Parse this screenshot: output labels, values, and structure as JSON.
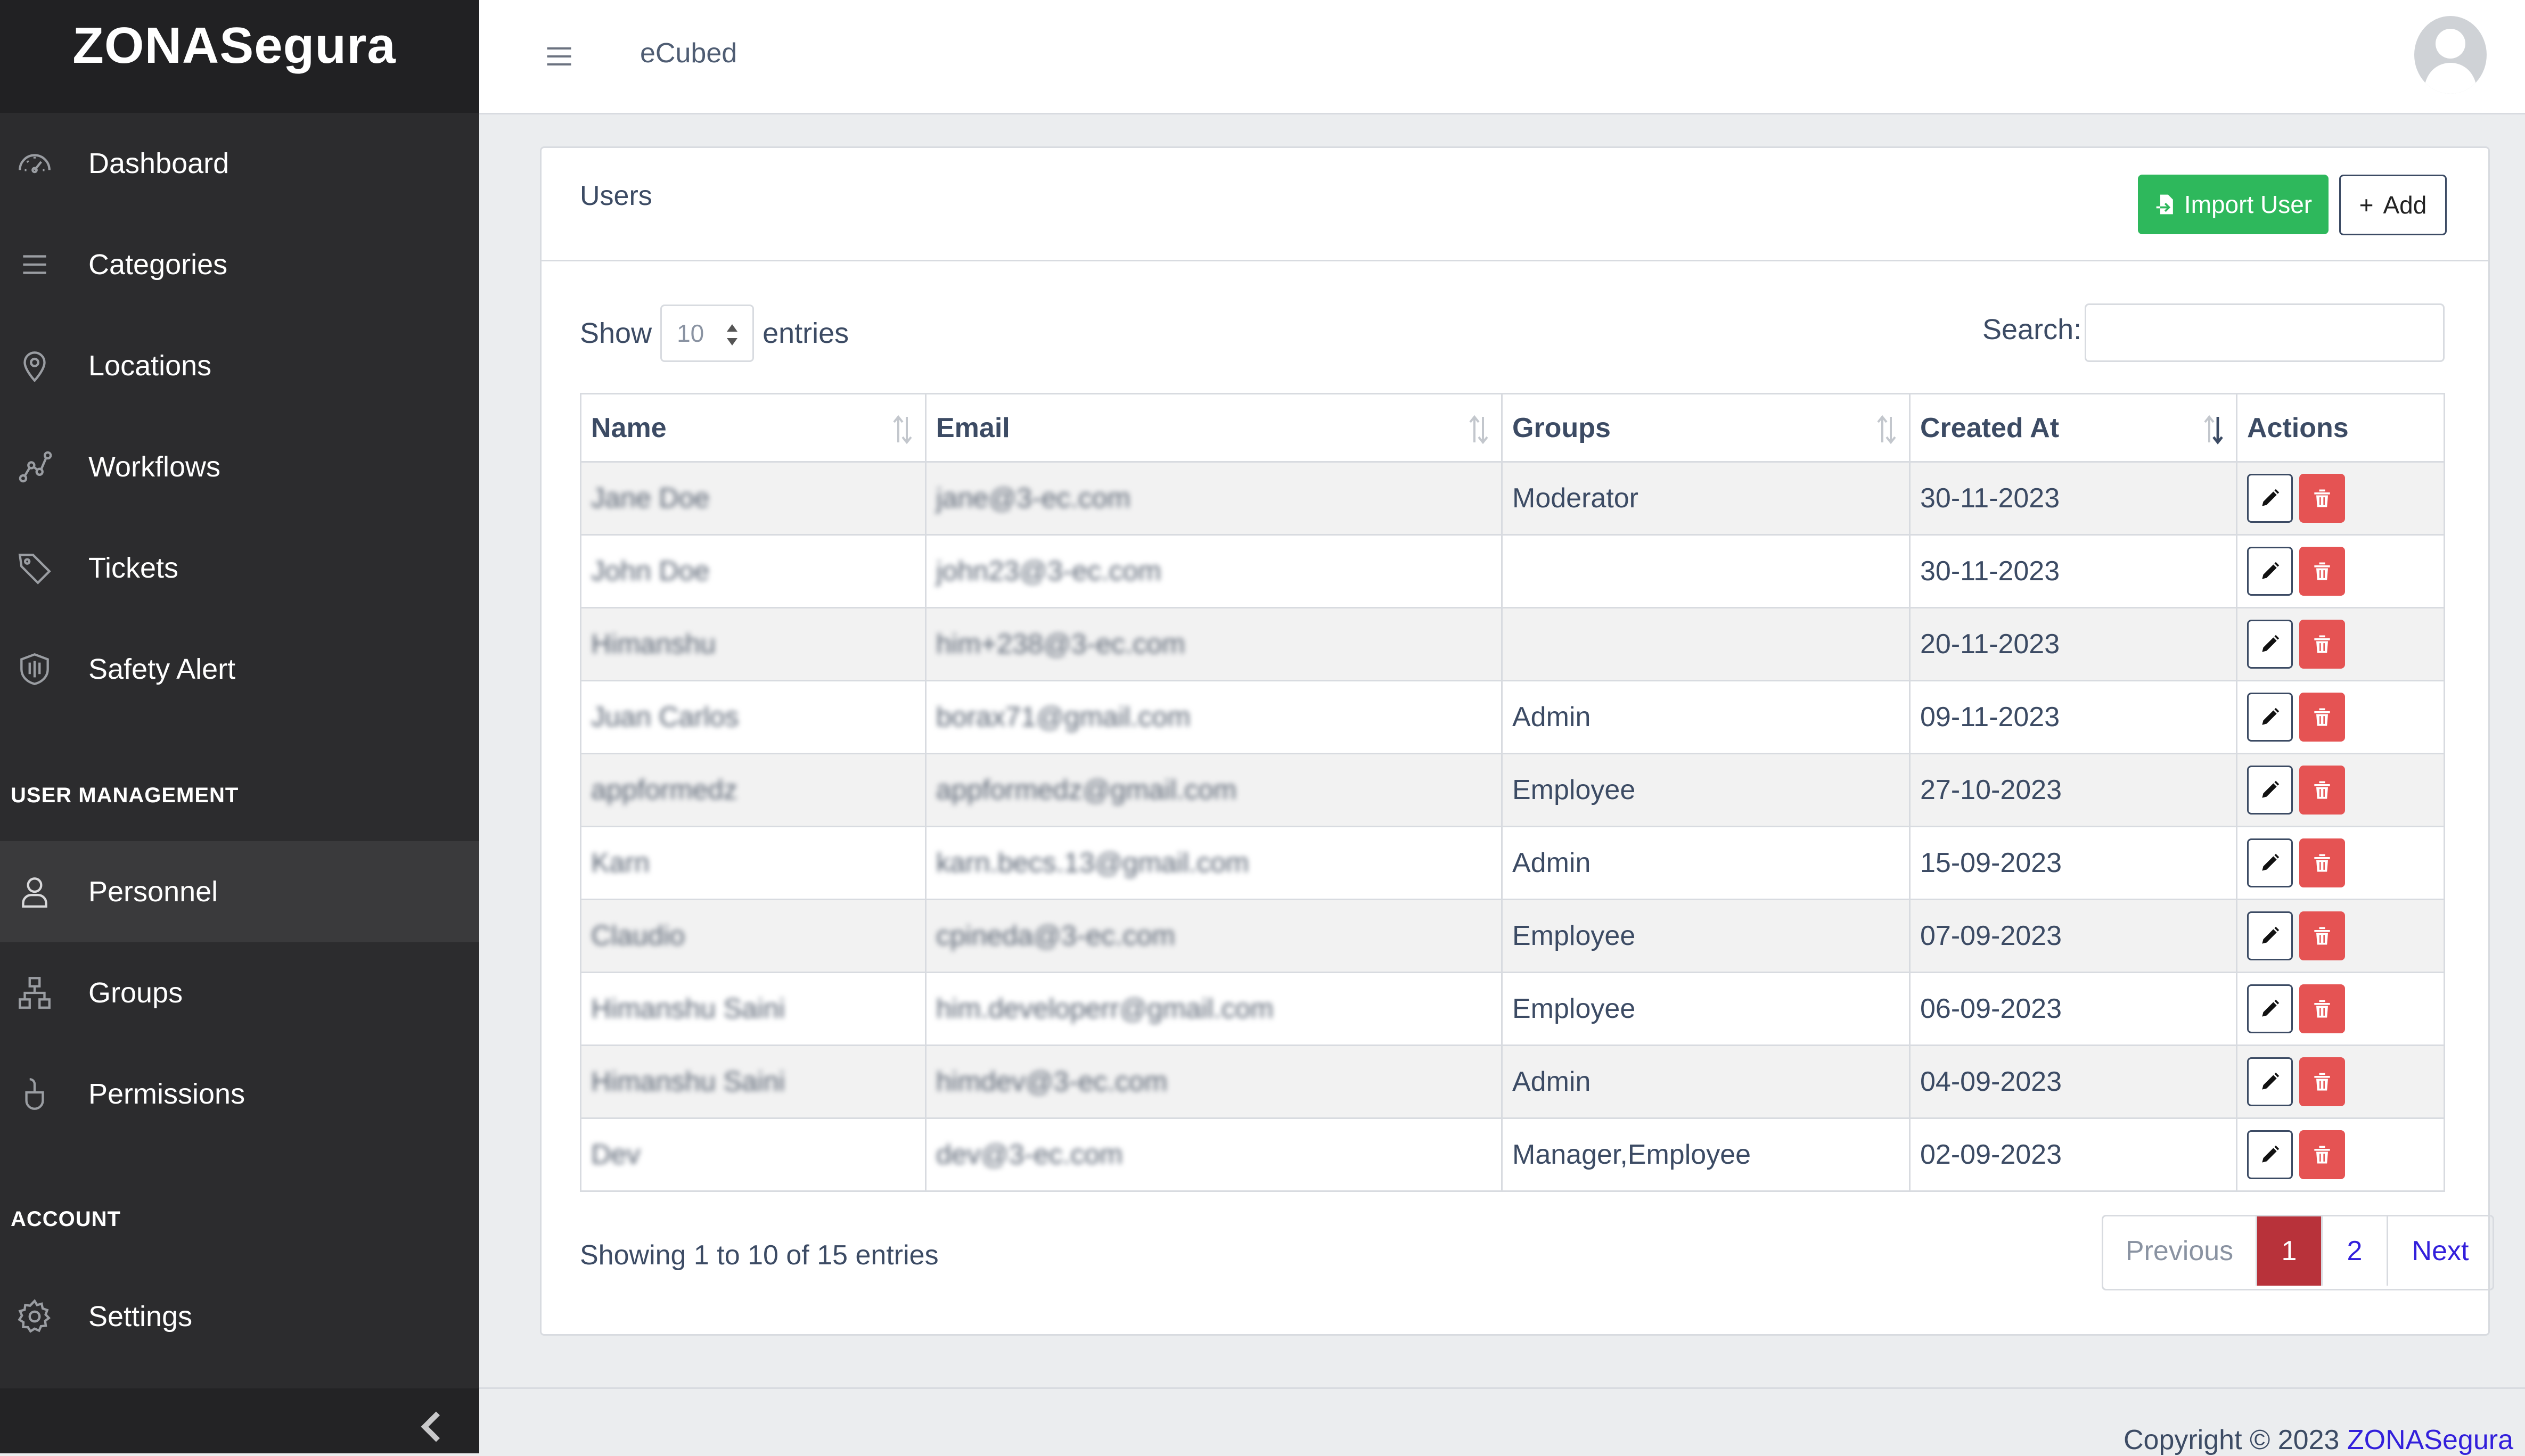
{
  "brand": "ZONASegura",
  "header": {
    "title": "eCubed"
  },
  "sidebar": {
    "items": [
      {
        "label": "Dashboard",
        "icon": "dashboard-icon"
      },
      {
        "label": "Categories",
        "icon": "list-icon"
      },
      {
        "label": "Locations",
        "icon": "location-pin-icon"
      },
      {
        "label": "Workflows",
        "icon": "workflow-icon"
      },
      {
        "label": "Tickets",
        "icon": "tag-icon"
      },
      {
        "label": "Safety Alert",
        "icon": "shield-icon"
      }
    ],
    "user_management_title": "USER MANAGEMENT",
    "user_management_items": [
      {
        "label": "Personnel",
        "icon": "user-icon",
        "active": true
      },
      {
        "label": "Groups",
        "icon": "sitemap-icon"
      },
      {
        "label": "Permissions",
        "icon": "mouse-icon"
      }
    ],
    "account_title": "ACCOUNT",
    "account_items": [
      {
        "label": "Settings",
        "icon": "gear-icon"
      }
    ]
  },
  "card": {
    "title": "Users",
    "import_label": "Import User",
    "add_label": "Add",
    "add_symbol": "+"
  },
  "table_controls": {
    "show_label": "Show",
    "entries_label": "entries",
    "page_size": "10",
    "search_label": "Search:",
    "search_value": ""
  },
  "table": {
    "columns": [
      "Name",
      "Email",
      "Groups",
      "Created At",
      "Actions"
    ],
    "rows": [
      {
        "name": "Jane Doe",
        "email": "jane@3-ec.com",
        "groups": "Moderator",
        "created": "30-11-2023"
      },
      {
        "name": "John Doe",
        "email": "john23@3-ec.com",
        "groups": "",
        "created": "30-11-2023"
      },
      {
        "name": "Himanshu",
        "email": "him+238@3-ec.com",
        "groups": "",
        "created": "20-11-2023"
      },
      {
        "name": "Juan Carlos",
        "email": "borax71@gmail.com",
        "groups": "Admin",
        "created": "09-11-2023"
      },
      {
        "name": "appformedz",
        "email": "appformedz@gmail.com",
        "groups": "Employee",
        "created": "27-10-2023"
      },
      {
        "name": "Karn",
        "email": "karn.becs.13@gmail.com",
        "groups": "Admin",
        "created": "15-09-2023"
      },
      {
        "name": "Claudio",
        "email": "cpineda@3-ec.com",
        "groups": "Employee",
        "created": "07-09-2023"
      },
      {
        "name": "Himanshu Saini",
        "email": "him.developerr@gmail.com",
        "groups": "Employee",
        "created": "06-09-2023"
      },
      {
        "name": "Himanshu Saini",
        "email": "himdev@3-ec.com",
        "groups": "Admin",
        "created": "04-09-2023"
      },
      {
        "name": "Dev",
        "email": "dev@3-ec.com",
        "groups": "Manager,Employee",
        "created": "02-09-2023"
      }
    ]
  },
  "pagination": {
    "info": "Showing 1 to 10 of 15 entries",
    "previous": "Previous",
    "pages": [
      "1",
      "2"
    ],
    "current": "1",
    "next": "Next"
  },
  "footer": {
    "prefix": "Copyright © 2023",
    "link": "ZONASegura"
  },
  "colors": {
    "sidebar_bg": "#2c2c2e",
    "success": "#2eb85c",
    "danger": "#e55353",
    "active_page": "#b8323a",
    "link": "#321fdb"
  }
}
